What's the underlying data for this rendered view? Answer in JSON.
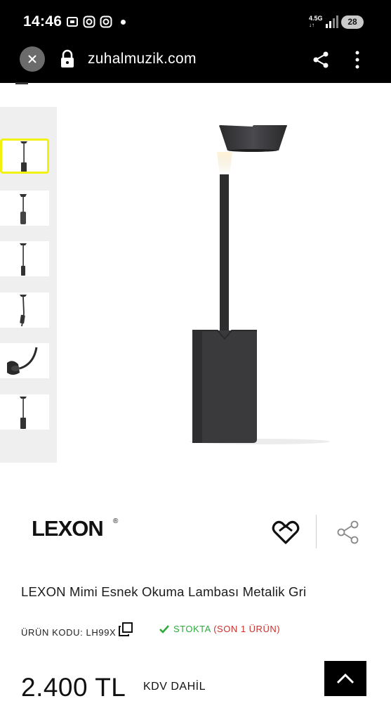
{
  "status_bar": {
    "time": "14:46",
    "network": "4.5G",
    "battery": "28",
    "icons": [
      "screenshot-icon",
      "instagram-icon",
      "instagram-icon"
    ]
  },
  "browser": {
    "url": "zuhalmuzik.com",
    "icons": [
      "close-icon",
      "lock-icon",
      "share-icon",
      "more-vert-icon"
    ]
  },
  "gallery": {
    "thumbnails": [
      {
        "icon": "lamp-straight-icon",
        "selected": true
      },
      {
        "icon": "lamp-short-icon",
        "selected": false
      },
      {
        "icon": "lamp-straight-icon",
        "selected": false
      },
      {
        "icon": "lamp-tilted-icon",
        "selected": false
      },
      {
        "icon": "lamp-bent-icon",
        "selected": false
      },
      {
        "icon": "lamp-straight-icon",
        "selected": false
      }
    ],
    "selected_color": "#f1f10c"
  },
  "product": {
    "brand": "LEXON",
    "brand_mark": "®",
    "title": "LEXON Mimi Esnek Okuma Lambası Metalik Gri",
    "code_label": "ÜRÜN KODU: LH99X",
    "stock_status": "STOKTA",
    "stock_extra": "(SON 1 ÜRÜN)",
    "price": "2.400 TL",
    "tax_note": "KDV DAHİL",
    "stock_color": "#2eaa3c",
    "stock_extra_color": "#c8312c"
  }
}
